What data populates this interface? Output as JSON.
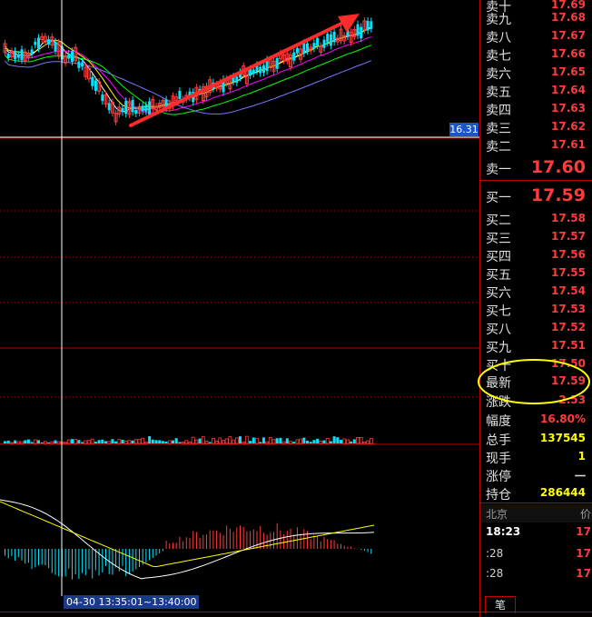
{
  "chart": {
    "price_tag": "16.31",
    "time_range": "04-30 13:35:01~13:40:00",
    "colors": {
      "up": "#ff3b3b",
      "down": "#00e5ff",
      "ma5": "#ffffff",
      "ma10": "#ffff00",
      "ma20": "#ff00ff",
      "ma30": "#00ff00",
      "ma60": "#7777ff",
      "arrow": "#ff2a2a",
      "grid": "#c00000",
      "crosshair": "#ffffff",
      "circle": "#ffff00"
    }
  },
  "quotes": {
    "sell": [
      {
        "label": "卖十",
        "price": "17.69"
      },
      {
        "label": "卖九",
        "price": "17.68"
      },
      {
        "label": "卖八",
        "price": "17.67"
      },
      {
        "label": "卖七",
        "price": "17.66"
      },
      {
        "label": "卖六",
        "price": "17.65"
      },
      {
        "label": "卖五",
        "price": "17.64"
      },
      {
        "label": "卖四",
        "price": "17.63"
      },
      {
        "label": "卖三",
        "price": "17.62"
      },
      {
        "label": "卖二",
        "price": "17.61"
      },
      {
        "label": "卖一",
        "price": "17.60"
      }
    ],
    "buy": [
      {
        "label": "买一",
        "price": "17.59"
      },
      {
        "label": "买二",
        "price": "17.58"
      },
      {
        "label": "买三",
        "price": "17.57"
      },
      {
        "label": "买四",
        "price": "17.56"
      },
      {
        "label": "买五",
        "price": "17.55"
      },
      {
        "label": "买六",
        "price": "17.54"
      },
      {
        "label": "买七",
        "price": "17.53"
      },
      {
        "label": "买八",
        "price": "17.52"
      },
      {
        "label": "买九",
        "price": "17.51"
      },
      {
        "label": "买十",
        "price": "17.50"
      }
    ]
  },
  "stats": {
    "latest_label": "最新",
    "latest_value": "17.59",
    "change_label": "涨跌",
    "change_value": "2.53",
    "amplitude_label": "幅度",
    "amplitude_value": "16.80%",
    "total_label": "总手",
    "total_value": "137545",
    "current_label": "现手",
    "current_value": "1",
    "limit_label": "涨停",
    "limit_value": "一",
    "position_label": "持仓",
    "position_value": "286444"
  },
  "ticks": {
    "header_city": "北京",
    "header_col": "价",
    "rows": [
      {
        "time": "18:23",
        "price": "17"
      },
      {
        "time": ":28",
        "price": "17"
      },
      {
        "time": ":28",
        "price": "17"
      }
    ]
  },
  "tabs": {
    "pen": "笔"
  }
}
